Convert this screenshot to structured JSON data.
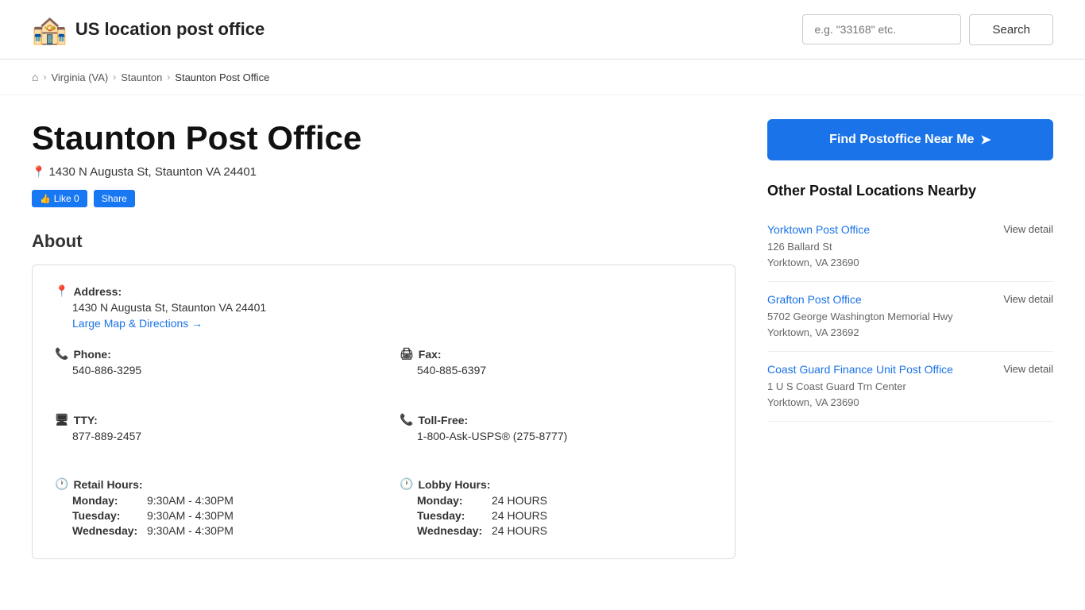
{
  "site": {
    "logo_icon": "🏤",
    "title": "US location post office",
    "search_placeholder": "e.g. \"33168\" etc.",
    "search_button": "Search"
  },
  "breadcrumb": {
    "home_icon": "⌂",
    "state": "Virginia (VA)",
    "city": "Staunton",
    "current": "Staunton Post Office"
  },
  "post_office": {
    "name": "Staunton Post Office",
    "address": "1430 N Augusta St, Staunton VA 24401",
    "fb_like": "Like 0",
    "fb_share": "Share"
  },
  "about": {
    "title": "About",
    "address_label": "Address:",
    "address_value": "1430 N Augusta St, Staunton VA 24401",
    "map_link": "Large Map & Directions →",
    "phone_label": "Phone:",
    "phone_value": "540-886-3295",
    "fax_label": "Fax:",
    "fax_value": "540-885-6397",
    "tty_label": "TTY:",
    "tty_value": "877-889-2457",
    "toll_free_label": "Toll-Free:",
    "toll_free_value": "1-800-Ask-USPS® (275-8777)",
    "retail_hours_label": "Retail Hours:",
    "lobby_hours_label": "Lobby Hours:",
    "retail_hours": [
      {
        "day": "Monday:",
        "time": "9:30AM - 4:30PM"
      },
      {
        "day": "Tuesday:",
        "time": "9:30AM - 4:30PM"
      },
      {
        "day": "Wednesday:",
        "time": "9:30AM - 4:30PM"
      }
    ],
    "lobby_hours": [
      {
        "day": "Monday:",
        "time": "24 HOURS"
      },
      {
        "day": "Tuesday:",
        "time": "24 HOURS"
      },
      {
        "day": "Wednesday:",
        "time": "24 HOURS"
      }
    ]
  },
  "sidebar": {
    "find_btn": "Find Postoffice Near Me",
    "nearby_title": "Other Postal Locations Nearby",
    "nearby_items": [
      {
        "name": "Yorktown Post Office",
        "address_line1": "126 Ballard St",
        "address_line2": "Yorktown, VA 23690",
        "view_detail": "View detail"
      },
      {
        "name": "Grafton Post Office",
        "address_line1": "5702 George Washington Memorial Hwy",
        "address_line2": "Yorktown, VA 23692",
        "view_detail": "View detail"
      },
      {
        "name": "Coast Guard Finance Unit Post Office",
        "address_line1": "1 U S Coast Guard Trn Center",
        "address_line2": "Yorktown, VA 23690",
        "view_detail": "View detail"
      }
    ]
  }
}
